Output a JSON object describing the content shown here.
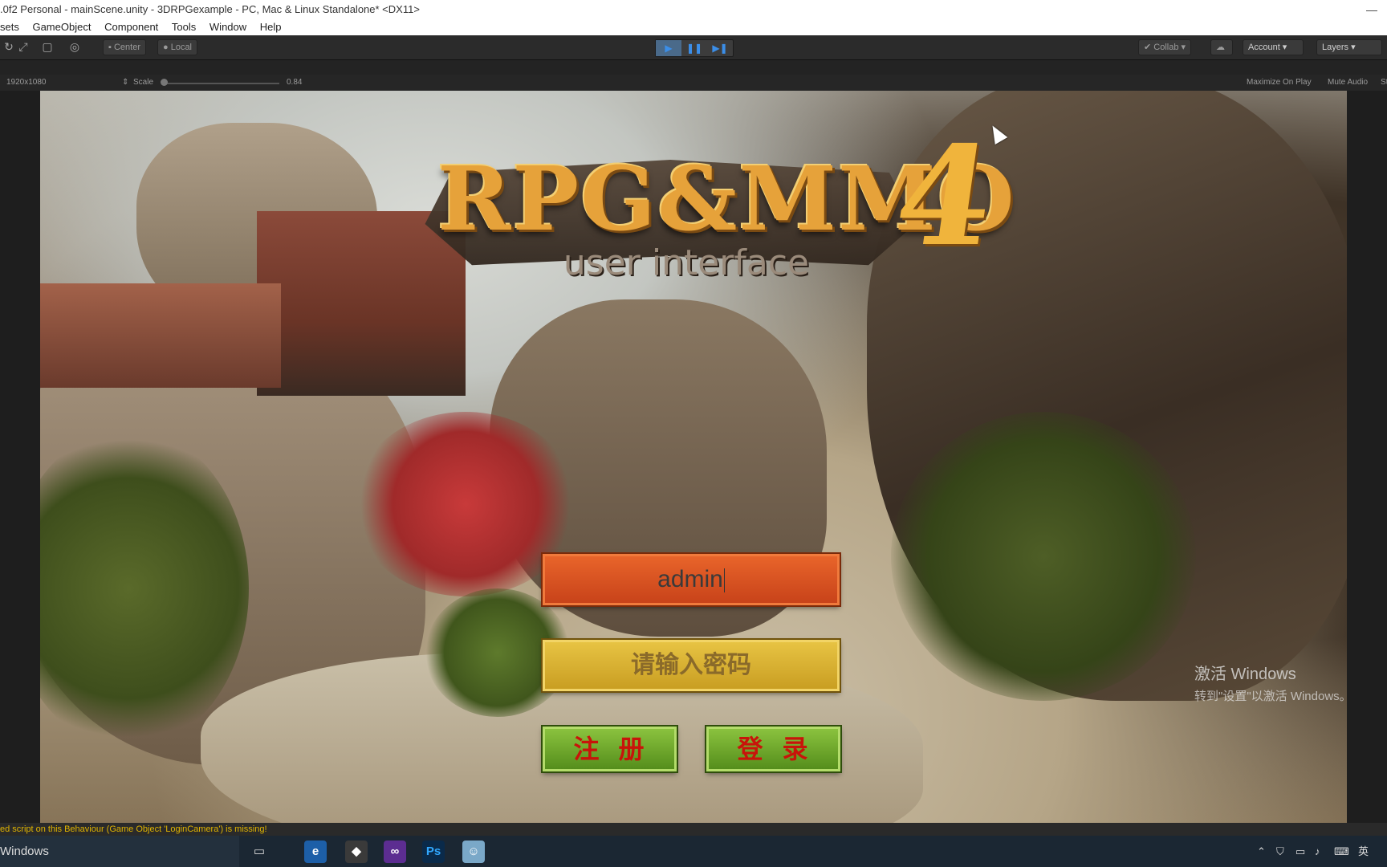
{
  "window": {
    "title": ".0f2 Personal - mainScene.unity - 3DRPGexample - PC, Mac & Linux Standalone* <DX11>",
    "minimize_glyph": "—"
  },
  "menu": {
    "items": [
      "sets",
      "GameObject",
      "Component",
      "Tools",
      "Window",
      "Help"
    ]
  },
  "toolbar": {
    "pivot_label": "Center",
    "space_label": "Local",
    "collab_label": "Collab",
    "account_label": "Account",
    "layers_label": "Layers"
  },
  "game_view": {
    "resolution": "1920x1080",
    "scale_label": "Scale",
    "scale_value": "0.84",
    "maximize_label": "Maximize On Play",
    "mute_label": "Mute Audio",
    "stats_label": "St"
  },
  "logo": {
    "main": "RPG&MMO",
    "number": "4",
    "sub": "user interface"
  },
  "login": {
    "username_value": "admin",
    "password_placeholder": "请输入密码",
    "register_label": "注册",
    "login_label": "登录"
  },
  "watermark": {
    "title": "激活 Windows",
    "subtitle": "转到\"设置\"以激活 Windows。"
  },
  "console": {
    "message": "ed script on this Behaviour (Game Object 'LoginCamera') is missing!"
  },
  "taskbar": {
    "search_text": "Windows",
    "ime_label": "英"
  },
  "colors": {
    "username_field": "#d9552a",
    "password_field": "#d8b033",
    "button_green": "#6fa82c",
    "button_text": "#c8140a",
    "play_accent": "#3b8ee8"
  }
}
